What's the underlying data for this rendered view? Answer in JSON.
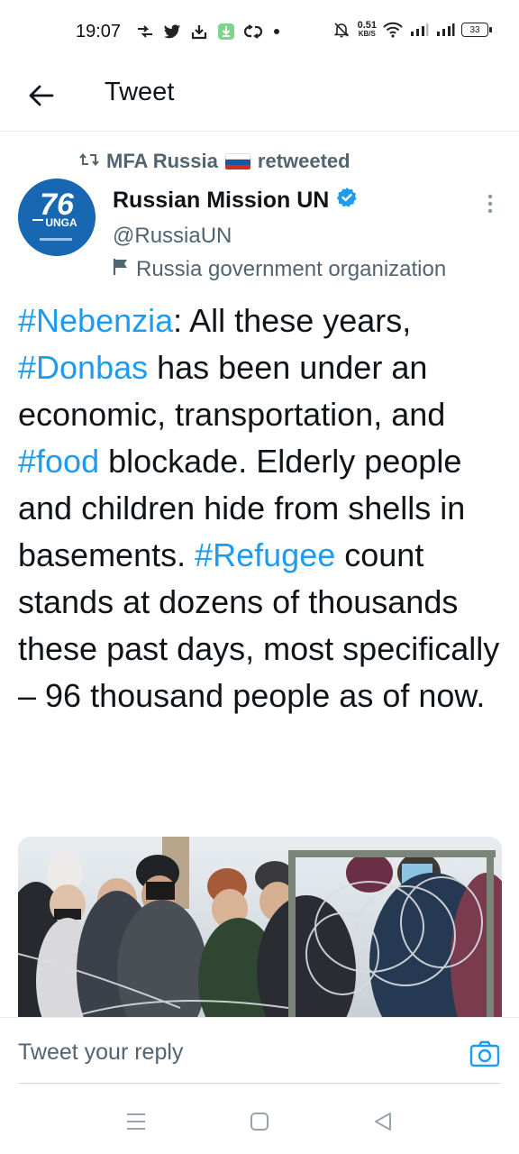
{
  "status_bar": {
    "time": "19:07",
    "net_speed_value": "0.51",
    "net_speed_unit": "KB/S",
    "battery": "33",
    "icons": [
      "cast-icon",
      "twitter-icon",
      "download-tray-icon",
      "download-app-icon",
      "sync-icon",
      "notification-dot",
      "mute-bell-icon",
      "wifi-icon",
      "signal-icon",
      "signal-icon"
    ]
  },
  "header": {
    "title": "Tweet",
    "back_icon": "arrow-left-icon"
  },
  "retweet": {
    "icon": "retweet-icon",
    "name": "MFA Russia",
    "suffix": "retweeted"
  },
  "author": {
    "name": "Russian Mission UN",
    "verified": true,
    "handle": "@RussiaUN",
    "label_icon": "flag-icon",
    "label": "Russia government organization",
    "avatar_text": "UNGA"
  },
  "tweet": {
    "segments": [
      {
        "text": "#Nebenzia",
        "hashtag": true
      },
      {
        "text": ": All these years, ",
        "hashtag": false
      },
      {
        "text": "#Donbas",
        "hashtag": true
      },
      {
        "text": " has been under an economic, transportation, and ",
        "hashtag": false
      },
      {
        "text": "#food",
        "hashtag": true
      },
      {
        "text": " blockade. Elderly people and children hide from shells in basements. ",
        "hashtag": false
      },
      {
        "text": "#Refugee",
        "hashtag": true
      },
      {
        "text": " count stands at dozens of thousands these past days, most specifically – 96 thousand people as of now.",
        "hashtag": false
      }
    ]
  },
  "reply": {
    "placeholder": "Tweet your reply",
    "camera_icon": "camera-icon"
  },
  "nav": {
    "icons": [
      "menu-icon",
      "home-square-icon",
      "back-triangle-icon"
    ]
  },
  "colors": {
    "accent": "#1d9bf0",
    "text": "#0f1419",
    "secondary": "#536471"
  }
}
